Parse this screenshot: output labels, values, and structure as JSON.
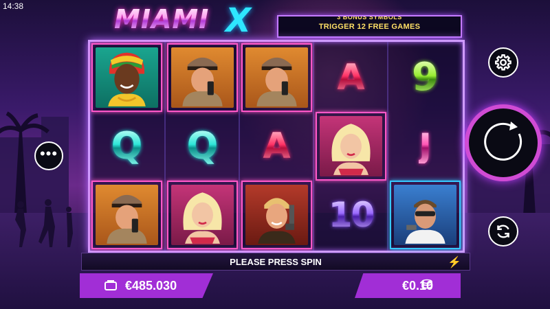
{
  "status_bar": {
    "time": "14:38"
  },
  "game": {
    "logo_word": "MIAMI",
    "logo_x": "X",
    "banner": {
      "top_text": "3 BONUS SYMBOLS",
      "bottom_text": "TRIGGER 12 FREE GAMES"
    }
  },
  "reels": [
    [
      "lady-dreadlocks-symbol",
      "Q",
      "cop-radio-symbol"
    ],
    [
      "cop-radio-symbol",
      "Q",
      "blonde-woman-symbol"
    ],
    [
      "cop-radio-symbol",
      "A",
      "gunman-symbol"
    ],
    [
      "A",
      "blonde-woman-symbol",
      "10"
    ],
    [
      "9",
      "J",
      "sunglasses-man-symbol"
    ]
  ],
  "message": "PLEASE PRESS SPIN",
  "balance": {
    "amount": "€485.030",
    "icon": "wallet-icon"
  },
  "bet": {
    "amount": "€0.10",
    "icon": "coins-icon"
  },
  "buttons": {
    "menu": "more-dots-icon",
    "settings": "gear-icon",
    "spin": "spin-arrow-icon",
    "autoplay": "autoplay-arrows-icon"
  },
  "colors": {
    "accent": "#a12ed6",
    "frame": "#cf9bff",
    "banner_text": "#ffe066"
  }
}
